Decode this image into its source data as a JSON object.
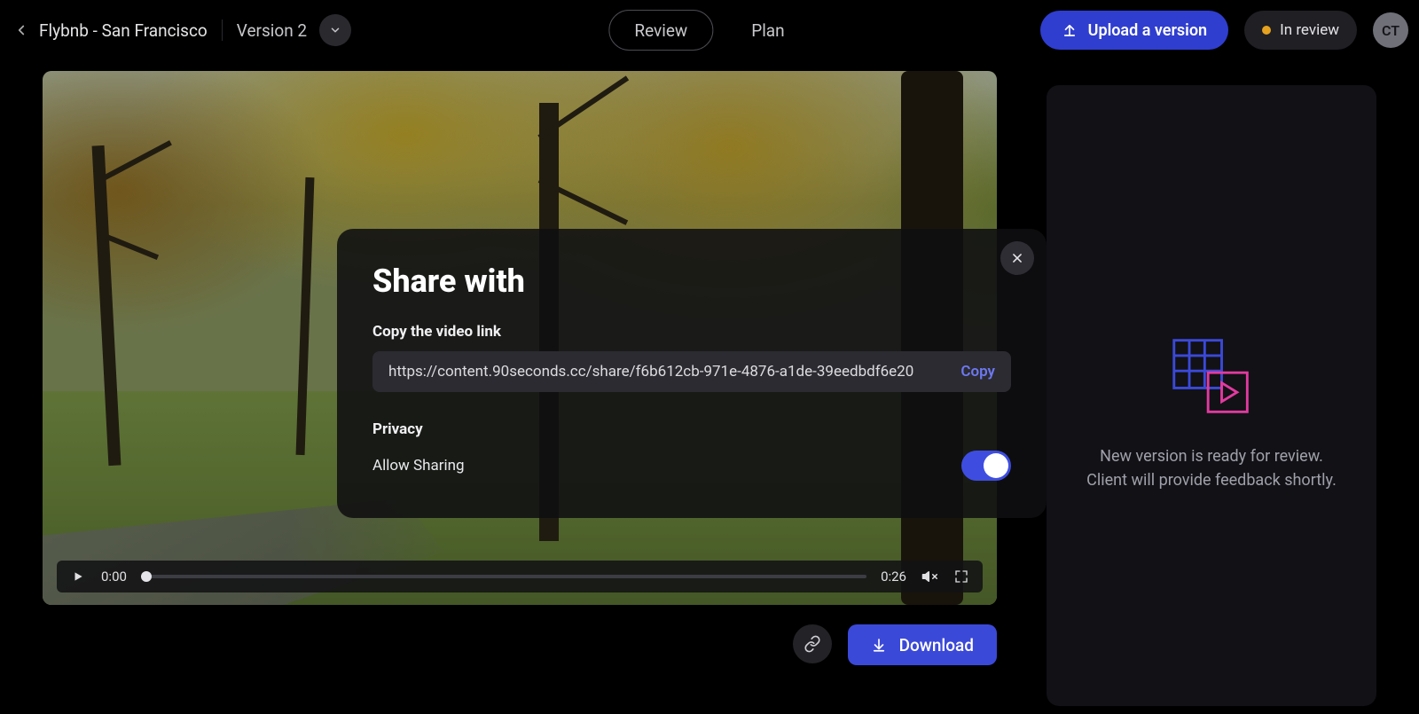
{
  "header": {
    "title": "Flybnb - San Francisco",
    "version_label": "Version 2",
    "tabs": {
      "review": "Review",
      "plan": "Plan"
    },
    "upload_label": "Upload a version",
    "status_label": "In review",
    "avatar_initials": "CT"
  },
  "video": {
    "current_time": "0:00",
    "duration": "0:26"
  },
  "actions": {
    "download_label": "Download"
  },
  "side": {
    "line1": "New version is ready for review.",
    "line2": "Client will provide feedback shortly."
  },
  "modal": {
    "title": "Share with",
    "copy_link_label": "Copy the video link",
    "url": "https://content.90seconds.cc/share/f6b612cb-971e-4876-a1de-39eedbdf6e20",
    "copy_action": "Copy",
    "privacy_label": "Privacy",
    "allow_sharing_label": "Allow Sharing",
    "allow_sharing_on": true
  },
  "colors": {
    "accent": "#3b49d8",
    "status_dot": "#e4a220",
    "copy_link": "#6d78f0"
  }
}
